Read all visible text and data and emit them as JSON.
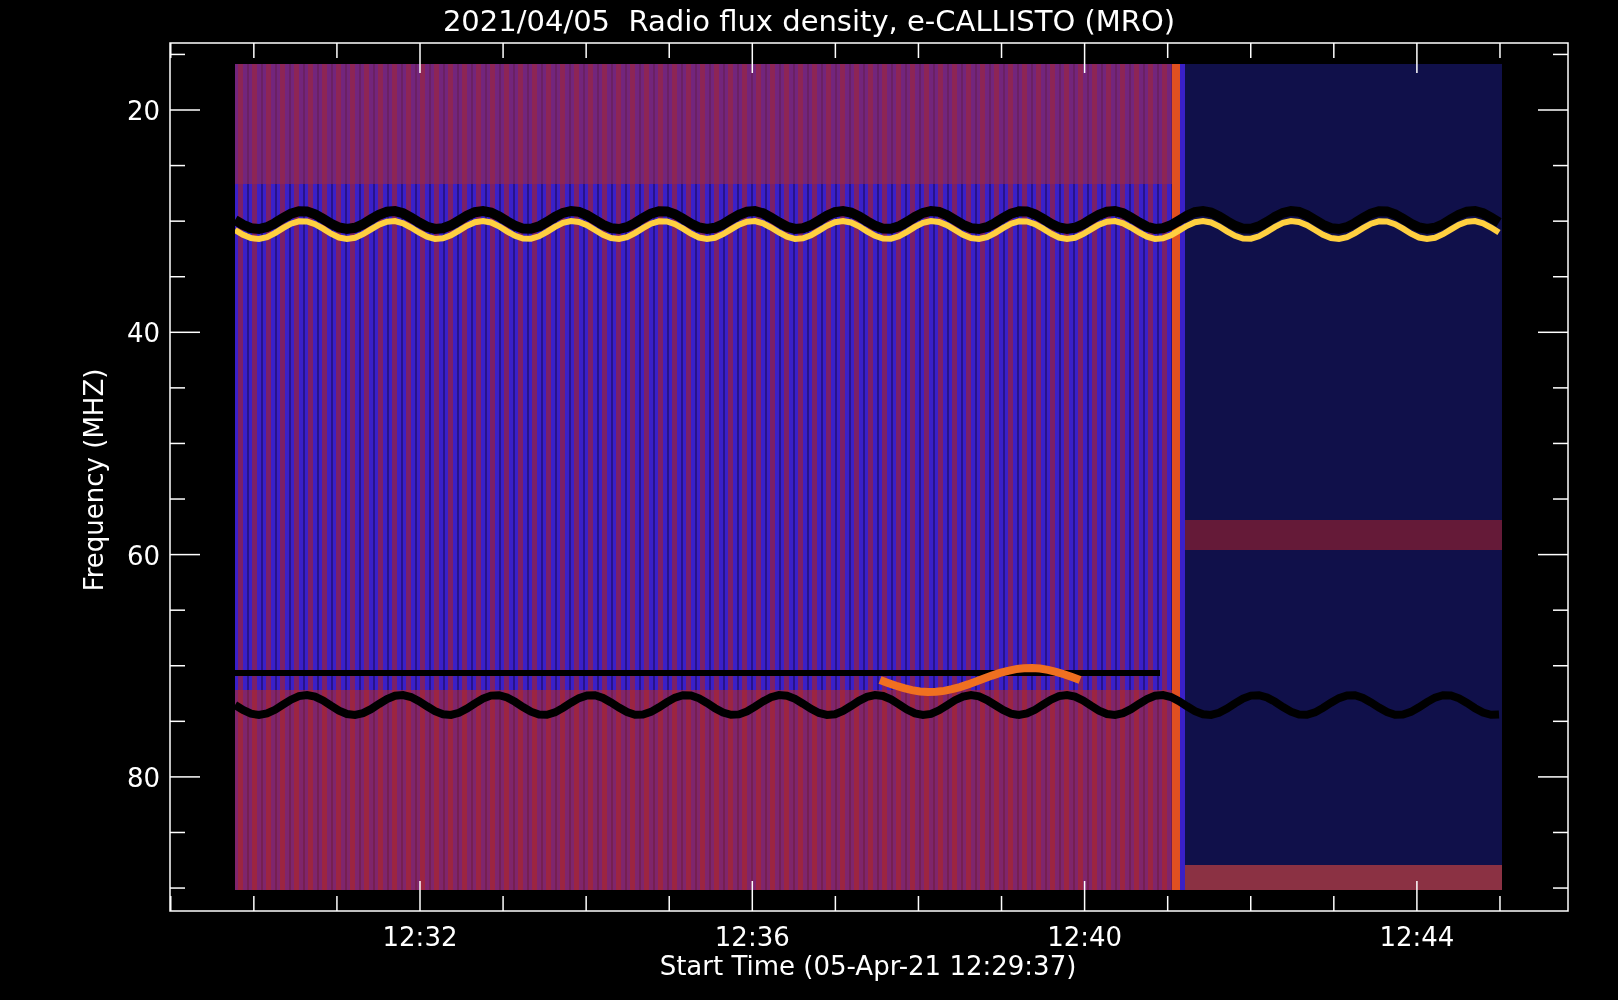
{
  "title": "2021/04/05  Radio flux density, e-CALLISTO (MRO)",
  "y_axis": {
    "label": "Frequency (MHZ)",
    "ticks": [
      "20",
      "40",
      "60",
      "80"
    ]
  },
  "x_axis": {
    "label": "Start Time (05-Apr-21 12:29:37)",
    "ticks": [
      "12:32",
      "12:36",
      "12:40",
      "12:44"
    ]
  }
}
